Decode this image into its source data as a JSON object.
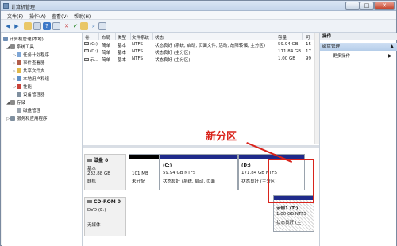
{
  "window": {
    "title": "计算机管理"
  },
  "menu": [
    "文件(F)",
    "操作(A)",
    "查看(V)",
    "帮助(H)"
  ],
  "tree": {
    "root": "计算机管理(本地)",
    "system_tools": "系统工具",
    "task_scheduler": "任务计划程序",
    "event_viewer": "事件查看器",
    "shared_folders": "共享文件夹",
    "local_users": "本地用户和组",
    "performance": "性能",
    "device_manager": "设备管理器",
    "storage": "存储",
    "disk_management": "磁盘管理",
    "services": "服务和应用程序"
  },
  "volumes": {
    "headers": [
      "卷",
      "布局",
      "类型",
      "文件系统",
      "状态",
      "容量",
      "可"
    ],
    "rows": [
      {
        "volume": "(C:)",
        "layout": "简单",
        "type": "基本",
        "fs": "NTFS",
        "status": "状态良好 (系统, 启动, 页面文件, 活动, 故障转储, 主分区)",
        "capacity": "59.94 GB",
        "free": "15"
      },
      {
        "volume": "(D:)",
        "layout": "简单",
        "type": "基本",
        "fs": "NTFS",
        "status": "状态良好 (主分区)",
        "capacity": "171.84 GB",
        "free": "17"
      },
      {
        "volume": "示...",
        "layout": "简单",
        "type": "基本",
        "fs": "NTFS",
        "status": "状态良好 (主分区)",
        "capacity": "1.00 GB",
        "free": "99"
      }
    ]
  },
  "disks": {
    "disk0": {
      "name": "磁盘 0",
      "type": "基本",
      "size": "232.88 GB",
      "status": "联机"
    },
    "cdrom": {
      "name": "CD-ROM 0",
      "type": "DVD (E:)",
      "status": "无媒体"
    }
  },
  "partitions": [
    {
      "size": "101 MB",
      "status": "未分配"
    },
    {
      "name": "(C:)",
      "size": "59.94 GB NTFS",
      "status": "状态良好 (系统, 启动, 页面"
    },
    {
      "name": "(D:)",
      "size": "171.84 GB NTFS",
      "status": "状态良好 (主分区)"
    },
    {
      "name": "示例1 (T:)",
      "size": "1.00 GB NTFS",
      "status": "状态良好 (主"
    }
  ],
  "actions": {
    "header": "操作",
    "section": "磁盘管理",
    "more": "更多操作"
  },
  "annotation": "新分区",
  "colors": {
    "accent_red": "#d9241c",
    "primary_partition": "#1f2a8a",
    "unallocated": "#000000"
  }
}
